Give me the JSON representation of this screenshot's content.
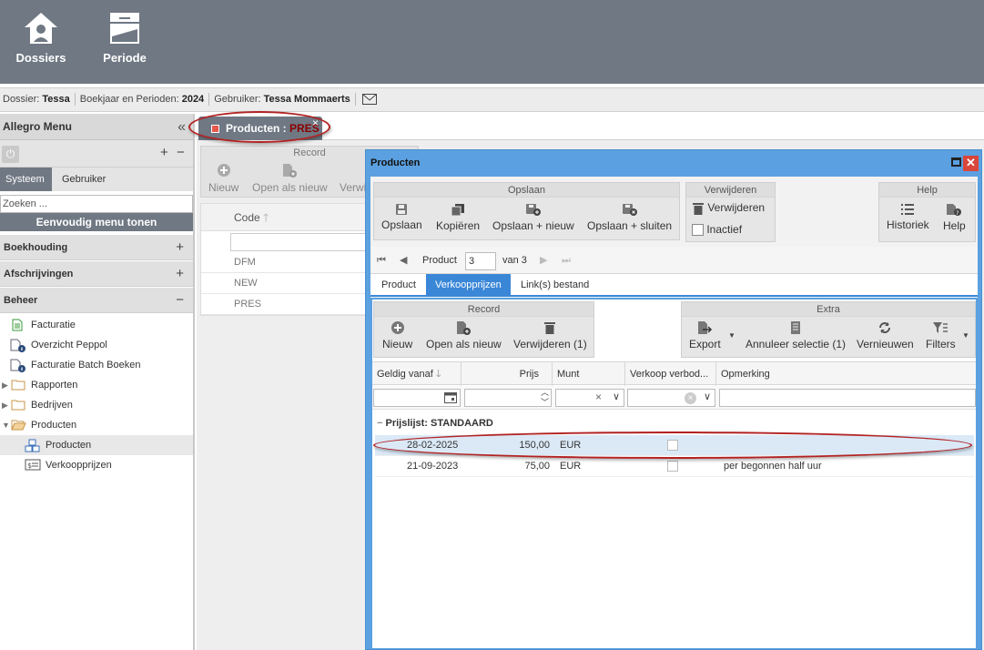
{
  "topbar": {
    "dossiers_label": "Dossiers",
    "periode_label": "Periode"
  },
  "infobar": {
    "dossier_label": "Dossier:",
    "dossier_value": "Tessa",
    "boekjaar_label": "Boekjaar en Perioden:",
    "boekjaar_value": "2024",
    "gebruiker_label": "Gebruiker:",
    "gebruiker_value": "Tessa Mommaerts"
  },
  "sidebar": {
    "title": "Allegro Menu",
    "tabs": [
      "Systeem",
      "Gebruiker"
    ],
    "search_placeholder": "Zoeken ...",
    "simple_menu_button": "Eenvoudig menu tonen",
    "sections": [
      {
        "label": "Boekhouding",
        "toggle": "+"
      },
      {
        "label": "Afschrijvingen",
        "toggle": "+"
      },
      {
        "label": "Beheer",
        "toggle": "−"
      }
    ],
    "items": [
      {
        "label": "Facturatie"
      },
      {
        "label": "Overzicht Peppol"
      },
      {
        "label": "Facturatie Batch Boeken"
      },
      {
        "label": "Rapporten"
      },
      {
        "label": "Bedrijven"
      },
      {
        "label": "Producten"
      },
      {
        "label": "Producten"
      },
      {
        "label": "Verkoopprijzen"
      }
    ]
  },
  "doctab": {
    "prefix": "Producten : ",
    "code": "PRES",
    "close": "×"
  },
  "background": {
    "record_title": "Record",
    "nieuw": "Nieuw",
    "open_als_nieuw": "Open als nieuw",
    "verwijderen_partial": "Verwi",
    "code_header": "Code",
    "codes": [
      "DFM",
      "NEW",
      "PRES"
    ]
  },
  "dialog": {
    "title": "Producten",
    "close": "✕",
    "opslaan_group": "Opslaan",
    "opslaan": "Opslaan",
    "kopieren": "Kopiëren",
    "opslaan_nieuw": "Opslaan + nieuw",
    "opslaan_sluiten": "Opslaan + sluiten",
    "verwijderen_group": "Verwijderen",
    "verwijderen": "Verwijderen",
    "inactief": "Inactief",
    "help_group": "Help",
    "historiek": "Historiek",
    "help": "Help",
    "nav": {
      "label": "Product",
      "value": "3",
      "of": "van 3"
    },
    "tabs": [
      "Product",
      "Verkoopprijzen",
      "Link(s) bestand"
    ],
    "record_group": "Record",
    "nieuw": "Nieuw",
    "open_als_nieuw": "Open als nieuw",
    "verwijderen_count": "Verwijderen (1)",
    "extra_group": "Extra",
    "export": "Export",
    "annuleer": "Annuleer selectie (1)",
    "vernieuwen": "Vernieuwen",
    "filters": "Filters",
    "columns": [
      "Geldig vanaf",
      "Prijs",
      "Munt",
      "Verkoop verbod...",
      "Opmerking"
    ],
    "group_label": "Prijslijst: STANDAARD",
    "rows": [
      {
        "date": "28-02-2025",
        "price": "150,00",
        "currency": "EUR",
        "note": ""
      },
      {
        "date": "21-09-2023",
        "price": "75,00",
        "currency": "EUR",
        "note": "per begonnen half uur"
      }
    ]
  },
  "colors": {
    "topbar": "#6f7883",
    "accent": "#3a87d8",
    "dialog_border": "#5ba0e0",
    "highlight": "#b22222"
  }
}
